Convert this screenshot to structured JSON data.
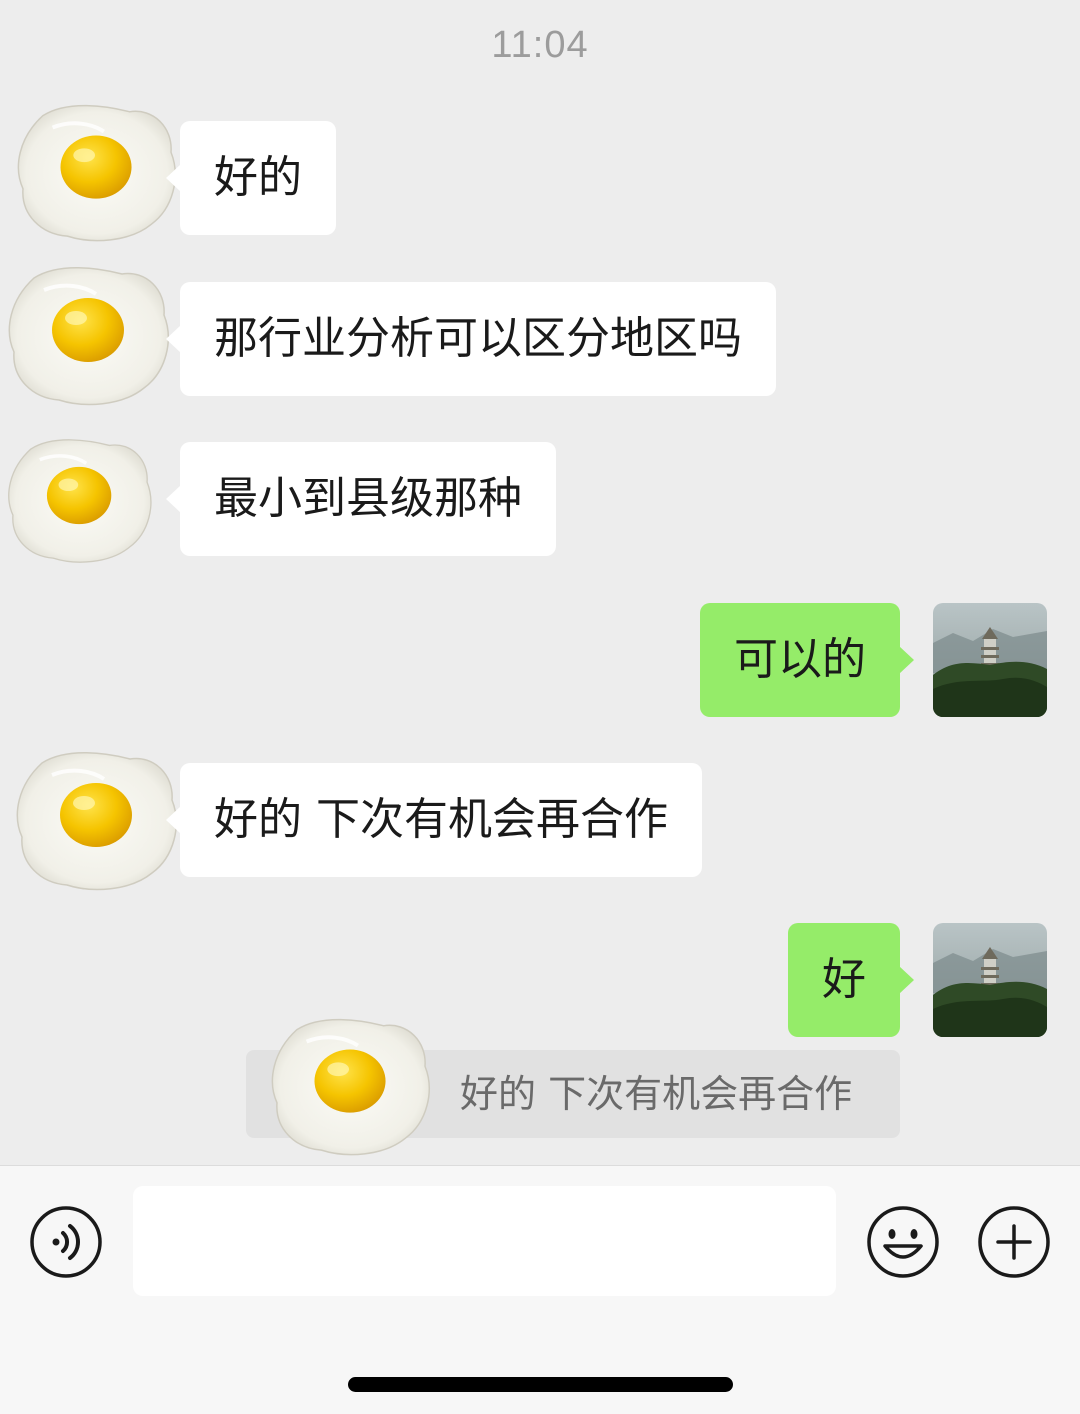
{
  "status": {
    "time": "11:04"
  },
  "messages": [
    {
      "side": "in",
      "text": "好的"
    },
    {
      "side": "in",
      "text": "那行业分析可以区分地区吗"
    },
    {
      "side": "in",
      "text": "最小到县级那种"
    },
    {
      "side": "out",
      "text": "可以的"
    },
    {
      "side": "in",
      "text": "好的 下次有机会再合作"
    },
    {
      "side": "out",
      "text": "好"
    }
  ],
  "quote": {
    "text": "好的 下次有机会再合作"
  },
  "input_bar": {
    "placeholder": "",
    "voice_icon": "voice-icon",
    "emoji_icon": "emoji-icon",
    "plus_icon": "plus-icon"
  },
  "colors": {
    "background": "#ededed",
    "incoming_bubble": "#ffffff",
    "outgoing_bubble": "#95ec69",
    "timestamp": "#9c9c9c"
  }
}
